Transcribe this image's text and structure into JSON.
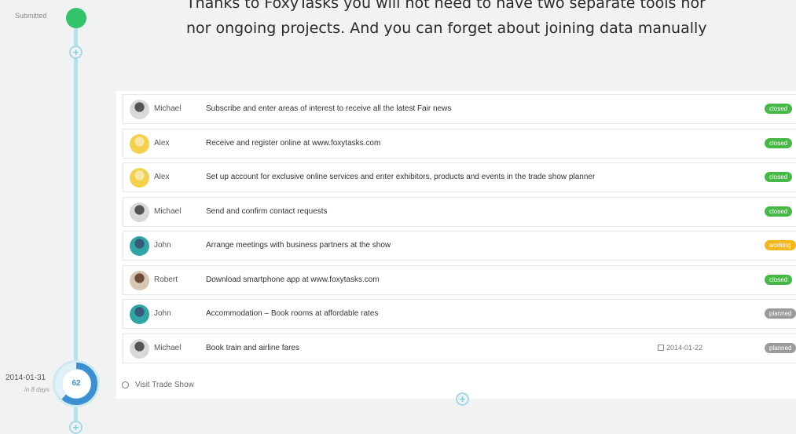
{
  "intro": {
    "line1": "Thanks to FoxyTasks you will not need to have two separate tools nor",
    "line2": "nor ongoing projects. And you can forget about joining data manually"
  },
  "timeline": {
    "submitted_label": "Submitted",
    "date": "2014-01-31",
    "in_days": "in 8 days",
    "progress_value": "62",
    "progress_fraction": 0.62,
    "milestone": "Visit Trade Show"
  },
  "tasks": [
    {
      "owner": "Michael",
      "title": "Subscribe and enter areas of interest to receive all the latest Fair news",
      "due": "",
      "status": "closed"
    },
    {
      "owner": "Alex",
      "title": "Receive and register online at www.foxytasks.com",
      "due": "",
      "status": "closed"
    },
    {
      "owner": "Alex",
      "title": "Set up account for exclusive online services and enter exhibitors, products and events in the trade show planner",
      "due": "",
      "status": "closed"
    },
    {
      "owner": "Michael",
      "title": "Send and confirm contact requests",
      "due": "",
      "status": "closed"
    },
    {
      "owner": "John",
      "title": "Arrange meetings with business partners at the show",
      "due": "",
      "status": "working"
    },
    {
      "owner": "Robert",
      "title": "Download smartphone app at www.foxytasks.com",
      "due": "",
      "status": "closed"
    },
    {
      "owner": "John",
      "title": "Accommodation – Book rooms at affordable rates",
      "due": "",
      "status": "planned"
    },
    {
      "owner": "Michael",
      "title": "Book train and airline fares",
      "due": "2014-01-22",
      "status": "planned"
    }
  ],
  "colors": {
    "closed": "#45b845",
    "working": "#f2b81e",
    "planned": "#9b9b9b",
    "timeline": "#b6e0ea",
    "submitted": "#33c46b",
    "progress": "#3c8fd0"
  },
  "icons": {
    "add": "plus-circle-icon",
    "calendar": "calendar-icon",
    "milestone": "circle-icon"
  }
}
